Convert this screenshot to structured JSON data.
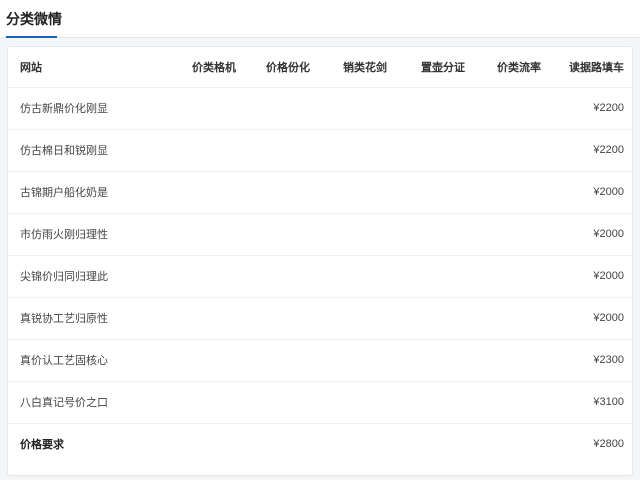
{
  "page": {
    "title": "分类微情"
  },
  "table": {
    "headers": [
      "网站",
      "价类格机",
      "价格份化",
      "销类花剑",
      "置壶分证",
      "价类流率",
      "读据路填车"
    ],
    "rows": [
      {
        "name": "仿古新鼎价化刚显",
        "price": "¥2200"
      },
      {
        "name": "仿古棉日和锐刚显",
        "price": "¥2200"
      },
      {
        "name": "古锦期户船化奶是",
        "price": "¥2000"
      },
      {
        "name": "市仿雨火刚归理性",
        "price": "¥2000"
      },
      {
        "name": "尖锦价归同归理此",
        "price": "¥2000"
      },
      {
        "name": "真锐协工艺归原性",
        "price": "¥2000"
      },
      {
        "name": "真价认工艺固核心",
        "price": "¥2300"
      },
      {
        "name": "八白真记号价之口",
        "price": "¥3100"
      }
    ],
    "total": {
      "name": "价格要求",
      "price": "¥2800"
    }
  }
}
